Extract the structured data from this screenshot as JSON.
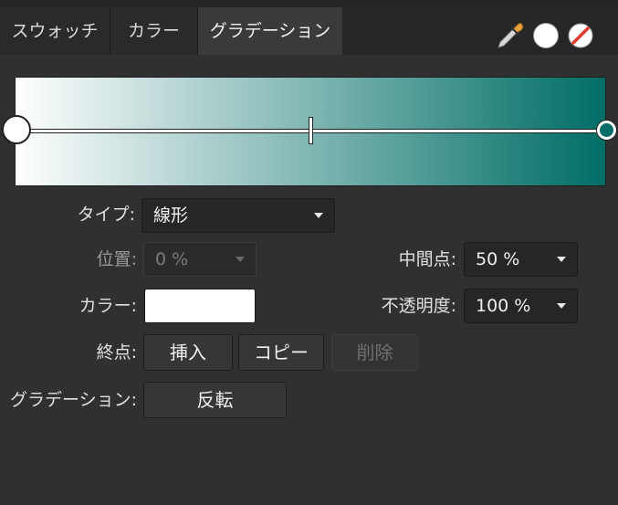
{
  "tabs": [
    {
      "label": "スウォッチ",
      "active": false
    },
    {
      "label": "カラー",
      "active": false
    },
    {
      "label": "グラデーション",
      "active": true
    }
  ],
  "header_icons": {
    "picker": "color-picker-icon",
    "fill": "white-fill-circle-icon",
    "none": "no-color-icon"
  },
  "gradient": {
    "start_color": "#ffffff",
    "end_color": "#006d66",
    "midpoint_percent": 50
  },
  "form": {
    "type_label": "タイプ:",
    "type_value": "線形",
    "position_label": "位置:",
    "position_value": "0 %",
    "midpoint_label": "中間点:",
    "midpoint_value": "50 %",
    "color_label": "カラー:",
    "color_value": "#ffffff",
    "opacity_label": "不透明度:",
    "opacity_value": "100 %",
    "endpoint_label": "終点:",
    "insert_label": "挿入",
    "copy_label": "コピー",
    "delete_label": "削除",
    "gradient_label": "グラデーション:",
    "reverse_label": "反転"
  }
}
